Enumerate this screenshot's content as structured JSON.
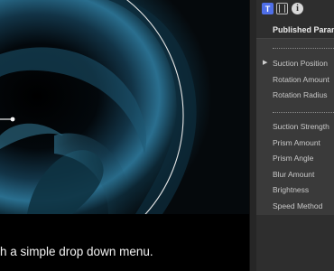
{
  "caption": "h a simple drop down menu.",
  "inspector": {
    "tabs": [
      {
        "label": "T",
        "icon": "text-icon"
      },
      {
        "label": "",
        "icon": "film-icon"
      },
      {
        "label": "i",
        "icon": "info-icon"
      }
    ],
    "section_title": "Published Parame",
    "groups": [
      {
        "items": [
          "Suction Position",
          "Rotation Amount",
          "Rotation Radius"
        ],
        "selected": "Suction Position"
      },
      {
        "items": [
          "Suction Strength",
          "Prism Amount",
          "Prism Angle",
          "Blur Amount",
          "Brightness",
          "Speed Method"
        ]
      }
    ]
  },
  "colors": {
    "accent": "#4f6fe8",
    "panel": "#2e2e2e",
    "menu": "#3a3a3a",
    "video_glow": "#2a6f8f"
  }
}
